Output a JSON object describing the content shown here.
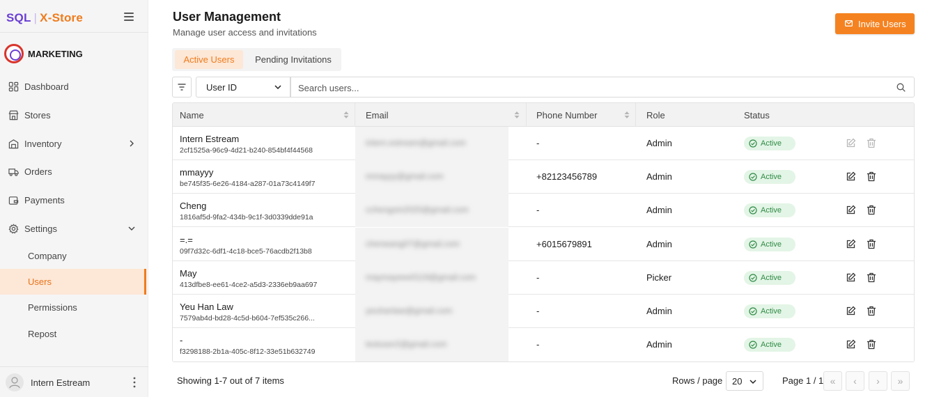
{
  "brand": {
    "sql": "SQL",
    "separator": "|",
    "store": "X-Store"
  },
  "org": {
    "name": "MARKETING"
  },
  "sidebar": {
    "items": [
      {
        "label": "Dashboard",
        "icon": "dashboard-icon"
      },
      {
        "label": "Stores",
        "icon": "store-icon"
      },
      {
        "label": "Inventory",
        "icon": "inventory-icon"
      },
      {
        "label": "Orders",
        "icon": "truck-icon"
      },
      {
        "label": "Payments",
        "icon": "payment-icon"
      },
      {
        "label": "Settings",
        "icon": "gear-icon"
      }
    ],
    "sub_items": [
      {
        "label": "Company"
      },
      {
        "label": "Users"
      },
      {
        "label": "Permissions"
      },
      {
        "label": "Repost"
      }
    ],
    "user": {
      "name": "Intern Estream"
    }
  },
  "header": {
    "title": "User Management",
    "subtitle": "Manage user access and invitations",
    "invite_label": "Invite Users"
  },
  "tabs": [
    {
      "label": "Active Users",
      "active": true
    },
    {
      "label": "Pending Invitations",
      "active": false
    }
  ],
  "filter": {
    "field_selected": "User ID",
    "search_placeholder": "Search users..."
  },
  "table": {
    "columns": [
      "Name",
      "Email",
      "Phone Number",
      "Role",
      "Status"
    ],
    "rows": [
      {
        "name": "Intern Estream",
        "id": "2cf1525a-96c9-4d21-b240-854bf4f44568",
        "email": "intern.estream@gmail.com",
        "phone": "-",
        "role": "Admin",
        "status": "Active",
        "actions_disabled": true
      },
      {
        "name": "mmayyy",
        "id": "be745f35-6e26-4184-a287-01a73c4149f7",
        "email": "mmayyy@gmail.com",
        "phone": "+82123456789",
        "role": "Admin",
        "status": "Active",
        "actions_disabled": false
      },
      {
        "name": "Cheng",
        "id": "1816af5d-9fa2-434b-9c1f-3d0339dde91a",
        "email": "cchengxin2020@gmail.com",
        "phone": "-",
        "role": "Admin",
        "status": "Active",
        "actions_disabled": false
      },
      {
        "name": "=.=",
        "id": "09f7d32c-6df1-4c18-bce5-76acdb2f13b8",
        "email": "chenwang07@gmail.com",
        "phone": "+6015679891",
        "role": "Admin",
        "status": "Active",
        "actions_disabled": false
      },
      {
        "name": "May",
        "id": "413dfbe8-ee61-4ce2-a5d3-2336eb9aa697",
        "email": "maymayeee0119@gmail.com",
        "phone": "-",
        "role": "Picker",
        "status": "Active",
        "actions_disabled": false
      },
      {
        "name": "Yeu Han Law",
        "id": "7579ab4d-bd28-4c5d-b604-7ef535c266...",
        "email": "yeuhanlaw@gmail.com",
        "phone": "-",
        "role": "Admin",
        "status": "Active",
        "actions_disabled": false
      },
      {
        "name": "-",
        "id": "f3298188-2b1a-405c-8f12-33e51b632749",
        "email": "testuser2@gmail.com",
        "phone": "-",
        "role": "Admin",
        "status": "Active",
        "actions_disabled": false
      }
    ]
  },
  "footer": {
    "count_text": "Showing 1-7 out of 7 items",
    "rows_label": "Rows / page",
    "rows_value": "20",
    "page_label": "Page 1 / 1",
    "first": "«",
    "prev": "‹",
    "next": "›",
    "last": "»"
  },
  "colors": {
    "accent": "#f58220",
    "brand_purple": "#6a3fd4",
    "active_green": "#2f8a45"
  }
}
